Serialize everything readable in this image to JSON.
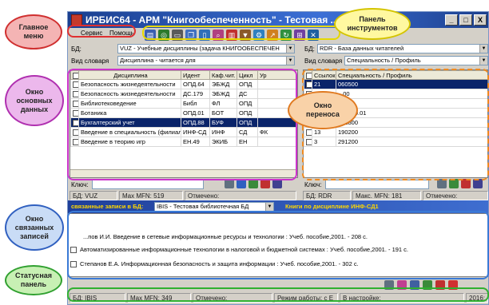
{
  "window": {
    "title": "ИРБИС64 - АРМ \"Книгообеспеченность\" - Тестовая ... еров",
    "min": "_",
    "max": "□",
    "close": "X"
  },
  "menu": {
    "service": "Сервис",
    "help": "Помощь"
  },
  "left_panel": {
    "bd_label": "БД:",
    "bd_value": "VUZ - Учебные дисциплины (задача КНИГООБЕСПЕЧЕН",
    "dict_label": "Вид словаря",
    "dict_value": "Дисциплина - читается для",
    "columns": [
      "Дисциплина",
      "Идент",
      "Каф.чит.",
      "Цикл",
      "Ур"
    ],
    "rows": [
      [
        "Безопасность жизнедеятельности",
        "ОПД.64",
        "ЭБЖД",
        "ОПД",
        ""
      ],
      [
        "Безопасность жизнедеятельности",
        "ДС.179",
        "ЭБЖД",
        "ДС",
        ""
      ],
      [
        "Библиотековедение",
        "Библ",
        "ФЛ",
        "ОПД",
        ""
      ],
      [
        "Ботаника",
        "ОПД.01",
        "БОТ",
        "ОПД",
        ""
      ],
      [
        "Бухгалтерский учет",
        "ОПД.88",
        "БУФ",
        "ОПД",
        ""
      ],
      [
        "Введение в специальность (филиал)",
        "ИНФ-СД",
        "ИНФ",
        "СД",
        "ФК"
      ],
      [
        "Введение в теорию игр",
        "ЕН.49",
        "ЭКИБ",
        "ЕН",
        ""
      ]
    ],
    "selected_row": 4,
    "key_label": "Ключ:",
    "status_bd": "БД: VUZ",
    "status_mfn": "Max MFN: 519",
    "status_marked": "Отмечено:"
  },
  "right_panel": {
    "bd_label": "БД:",
    "bd_value": "RDR - База данных читателей",
    "dict_label": "Вид словаря",
    "dict_value": "Специальность / Профиль",
    "columns": [
      "Ссылок",
      "Специальность / Профиль"
    ],
    "rows": [
      [
        "21",
        "060500"
      ],
      [
        "",
        "...00"
      ],
      [
        "",
        "...0"
      ],
      [
        "2",
        "060800.01"
      ],
      [
        "6",
        "061800"
      ],
      [
        "13",
        "190200"
      ],
      [
        "3",
        "291200"
      ]
    ],
    "selected_row": 0,
    "key_label": "Ключ:",
    "status_bd": "БД: RDR",
    "status_mfn": "Макс. MFN: 181",
    "status_marked": "Отмечено:"
  },
  "linked": {
    "label": "связанные записи в БД:",
    "db": "IBIS - Тестовая библиотечная БД",
    "books_label": "Книги по дисциплине ИНФ-СД1",
    "items": [
      "...пов И.И. Введение в сетевые информационные ресурсы и технологии : Учеб. пособие,2001. - 208 с.",
      "Автоматизированные информационные технологии в налоговой и бюджетной системах : Учеб. пособие,2001. - 191 с.",
      "Степанов Е.А. Информационная безопасность и защита информации : Учеб. пособие,2001. - 302 с."
    ]
  },
  "statusbar": {
    "bd": "БД: IBIS",
    "mfn": "Max MFN: 349",
    "marked": "Отмечено:",
    "mode": "Режим работы: с Е",
    "settings": "В настройке:",
    "year": "2016:"
  },
  "callouts": {
    "main_menu": "Главное\nменю",
    "toolbar": "Панель\nинструментов",
    "main_data": "Окно\nосновных\nданных",
    "transfer": "Окно\nпереноса",
    "linked": "Окно\nсвязанных\nзаписей",
    "status": "Статусная\nпанель"
  },
  "colors": {
    "callout_main_menu": "#f4b4b4",
    "callout_toolbar": "#fff8a0",
    "callout_main_data": "#ecb8ec",
    "callout_transfer": "#f9d2a8",
    "callout_linked": "#c9dcf6",
    "callout_status": "#c8f0b4"
  }
}
